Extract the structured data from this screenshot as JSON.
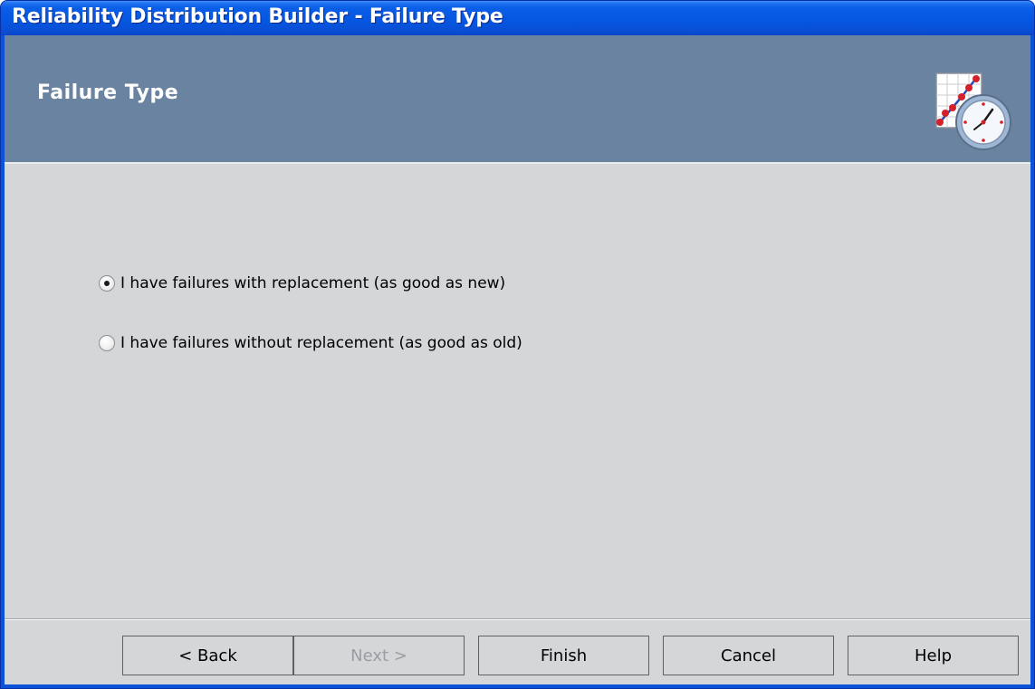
{
  "window": {
    "title": "Reliability Distribution Builder - Failure Type"
  },
  "header": {
    "title": "Failure Type",
    "icon": "distribution-clock-icon"
  },
  "options": [
    {
      "label": "I have failures with replacement (as good as new)",
      "selected": true
    },
    {
      "label": "I have failures without replacement (as good as old)",
      "selected": false
    }
  ],
  "buttons": {
    "back": {
      "label": "< Back",
      "enabled": true
    },
    "next": {
      "label": "Next >",
      "enabled": false
    },
    "finish": {
      "label": "Finish",
      "enabled": true
    },
    "cancel": {
      "label": "Cancel",
      "enabled": true
    },
    "help": {
      "label": "Help",
      "enabled": true
    }
  },
  "colors": {
    "titlebar": "#0556e0",
    "header_band": "#6983a0",
    "client_bg": "#d4d6d8",
    "disabled_text": "#9a9ea3"
  }
}
